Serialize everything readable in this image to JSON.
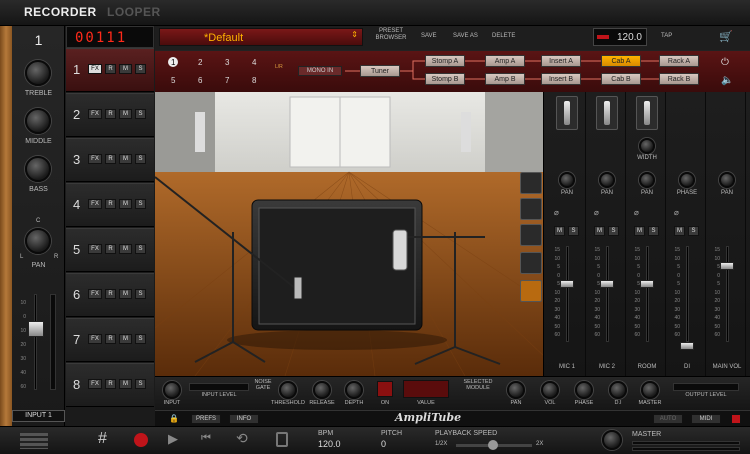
{
  "app": {
    "tab_recorder": "RECORDER",
    "tab_looper": "LOOPER",
    "logo": "AmpliTube"
  },
  "left": {
    "track_number": "1",
    "treble_label": "TREBLE",
    "middle_label": "MIDDLE",
    "bass_label": "BASS",
    "pan_label": "PAN",
    "pan_l": "L",
    "pan_c": "C",
    "pan_r": "R",
    "input_label": "INPUT 1",
    "scale": [
      "10",
      "0",
      "10",
      "20",
      "30",
      "40",
      "60"
    ]
  },
  "counter": "00111",
  "tracks": [
    {
      "num": "1",
      "fx": "FX",
      "r": "R",
      "m": "M",
      "s": "S"
    },
    {
      "num": "2",
      "fx": "FX",
      "r": "R",
      "m": "M",
      "s": "S"
    },
    {
      "num": "3",
      "fx": "FX",
      "r": "R",
      "m": "M",
      "s": "S"
    },
    {
      "num": "4",
      "fx": "FX",
      "r": "R",
      "m": "M",
      "s": "S"
    },
    {
      "num": "5",
      "fx": "FX",
      "r": "R",
      "m": "M",
      "s": "S"
    },
    {
      "num": "6",
      "fx": "FX",
      "r": "R",
      "m": "M",
      "s": "S"
    },
    {
      "num": "7",
      "fx": "FX",
      "r": "R",
      "m": "M",
      "s": "S"
    },
    {
      "num": "8",
      "fx": "FX",
      "r": "R",
      "m": "M",
      "s": "S"
    }
  ],
  "preset": {
    "name": "*Default",
    "browser": "PRESET\nBROWSER",
    "save": "SAVE",
    "save_as": "SAVE AS",
    "delete": "DELETE",
    "tempo": "120.0",
    "tap": "TAP"
  },
  "chain": {
    "nums_top": [
      "1",
      "2",
      "3",
      "4"
    ],
    "nums_bottom": [
      "5",
      "6",
      "7",
      "8"
    ],
    "mono_in": "MONO IN",
    "tuner": "Tuner",
    "stomp_a": "Stomp A",
    "stomp_b": "Stomp B",
    "amp_a": "Amp A",
    "amp_b": "Amp B",
    "insert_a": "Insert A",
    "insert_b": "Insert B",
    "cab_a": "Cab A",
    "cab_b": "Cab B",
    "rack_a": "Rack A",
    "rack_b": "Rack B",
    "lr": "L/R"
  },
  "mixer": {
    "width_label": "WIDTH",
    "pan_label": "PAN",
    "phase_label": "PHASE",
    "m": "M",
    "s": "S",
    "scale": [
      "15",
      "10",
      "5",
      "0",
      "5",
      "10",
      "20",
      "30",
      "40",
      "50",
      "60"
    ],
    "strips": [
      "MIC 1",
      "MIC 2",
      "ROOM",
      "DI",
      "MAIN VOL"
    ]
  },
  "controls": {
    "input": "INPUT",
    "input_level": "INPUT  LEVEL",
    "noise_gate": "NOISE\nGATE",
    "threshold": "THRESHOLD",
    "release": "RELEASE",
    "depth": "DEPTH",
    "on": "ON",
    "value": "VALUE",
    "selected_module": "SELECTED\nMODULE",
    "pan": "PAN",
    "vol": "VOL",
    "phase": "PHASE",
    "di": "D.I",
    "master": "MASTER",
    "output_level": "OUTPUT  LEVEL",
    "prefs": "PREFS",
    "info": "INFO",
    "auto": "AUTO",
    "midi": "MIDI"
  },
  "transport": {
    "bpm_label": "BPM",
    "bpm_value": "120.0",
    "pitch_label": "PITCH",
    "pitch_value": "0",
    "speed_label": "PLAYBACK SPEED",
    "speed_min": "1/2X",
    "speed_max": "2X",
    "master_label": "MASTER"
  },
  "colors": {
    "accent_red": "#c0141a",
    "amber": "#ffb300",
    "seg_red": "#ff2a1a"
  }
}
